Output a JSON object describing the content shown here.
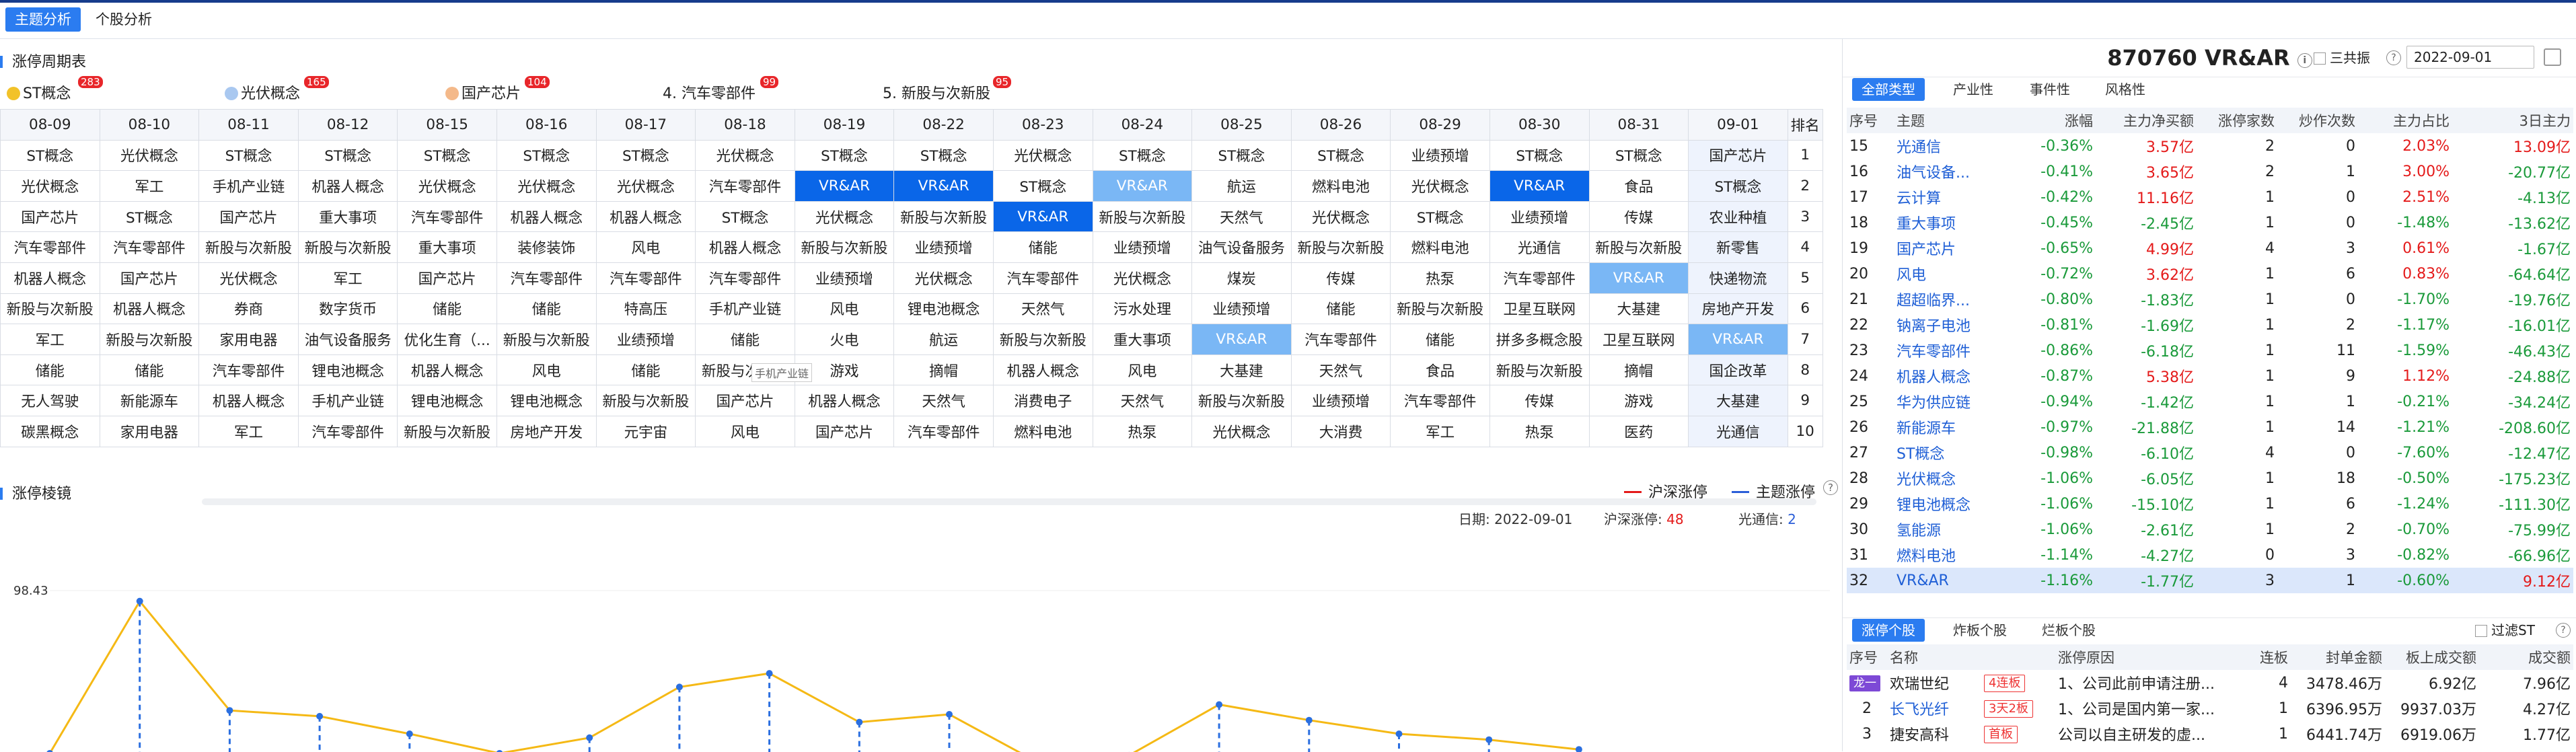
{
  "top_tabs": [
    "主题分析",
    "个股分析"
  ],
  "left": {
    "cycle_title": "涨停周期表",
    "hot": [
      {
        "label": "ST概念",
        "count": "283",
        "color": "#f2c229"
      },
      {
        "label": "光伏概念",
        "count": "165",
        "color": "#a9c8f0"
      },
      {
        "label": "国产芯片",
        "count": "104",
        "color": "#f4b98a"
      },
      {
        "label": "4. 汽车零部件",
        "count": "99",
        "color": ""
      },
      {
        "label": "5. 新股与次新股",
        "count": "95",
        "color": ""
      }
    ],
    "dates": [
      "08-09",
      "08-10",
      "08-11",
      "08-12",
      "08-15",
      "08-16",
      "08-17",
      "08-18",
      "08-19",
      "08-22",
      "08-23",
      "08-24",
      "08-25",
      "08-26",
      "08-29",
      "08-30",
      "08-31",
      "09-01"
    ],
    "rank_header": "排名",
    "rows": [
      [
        "ST概念",
        "光伏概念",
        "ST概念",
        "ST概念",
        "ST概念",
        "ST概念",
        "ST概念",
        "光伏概念",
        "ST概念",
        "ST概念",
        "光伏概念",
        "ST概念",
        "ST概念",
        "ST概念",
        "业绩预增",
        "ST概念",
        "ST概念",
        "国产芯片"
      ],
      [
        "光伏概念",
        "军工",
        "手机产业链",
        "机器人概念",
        "光伏概念",
        "光伏概念",
        "光伏概念",
        "汽车零部件",
        "VR&AR",
        "VR&AR",
        "ST概念",
        "VR&AR",
        "航运",
        "燃料电池",
        "光伏概念",
        "VR&AR",
        "食品",
        "ST概念"
      ],
      [
        "国产芯片",
        "ST概念",
        "国产芯片",
        "重大事项",
        "汽车零部件",
        "机器人概念",
        "机器人概念",
        "ST概念",
        "光伏概念",
        "新股与次新股",
        "VR&AR",
        "新股与次新股",
        "天然气",
        "光伏概念",
        "ST概念",
        "业绩预增",
        "传媒",
        "农业种植"
      ],
      [
        "汽车零部件",
        "汽车零部件",
        "新股与次新股",
        "新股与次新股",
        "重大事项",
        "装修装饰",
        "风电",
        "机器人概念",
        "新股与次新股",
        "业绩预增",
        "储能",
        "业绩预增",
        "油气设备服务",
        "新股与次新股",
        "燃料电池",
        "光通信",
        "新股与次新股",
        "新零售"
      ],
      [
        "机器人概念",
        "国产芯片",
        "光伏概念",
        "军工",
        "国产芯片",
        "汽车零部件",
        "汽车零部件",
        "汽车零部件",
        "业绩预增",
        "光伏概念",
        "汽车零部件",
        "光伏概念",
        "煤炭",
        "传媒",
        "热泵",
        "汽车零部件",
        "VR&AR",
        "快递物流"
      ],
      [
        "新股与次新股",
        "机器人概念",
        "券商",
        "数字货币",
        "储能",
        "储能",
        "特高压",
        "手机产业链",
        "风电",
        "锂电池概念",
        "天然气",
        "污水处理",
        "业绩预增",
        "储能",
        "新股与次新股",
        "卫星互联网",
        "大基建",
        "房地产开发"
      ],
      [
        "军工",
        "新股与次新股",
        "家用电器",
        "油气设备服务",
        "优化生育（...",
        "新股与次新股",
        "业绩预增",
        "储能",
        "火电",
        "航运",
        "新股与次新股",
        "重大事项",
        "VR&AR",
        "汽车零部件",
        "储能",
        "拼多多概念股",
        "卫星互联网",
        "VR&AR"
      ],
      [
        "储能",
        "储能",
        "汽车零部件",
        "锂电池概念",
        "机器人概念",
        "风电",
        "储能",
        "新股与次新股",
        "游戏",
        "摘帽",
        "机器人概念",
        "风电",
        "大基建",
        "天然气",
        "食品",
        "新股与次新股",
        "摘帽",
        "国企改革"
      ],
      [
        "无人驾驶",
        "新能源车",
        "机器人概念",
        "手机产业链",
        "锂电池概念",
        "锂电池概念",
        "新股与次新股",
        "国产芯片",
        "机器人概念",
        "天然气",
        "消费电子",
        "天然气",
        "新股与次新股",
        "业绩预增",
        "汽车零部件",
        "传媒",
        "游戏",
        "大基建"
      ],
      [
        "碳黑概念",
        "家用电器",
        "军工",
        "汽车零部件",
        "新股与次新股",
        "房地产开发",
        "元宇宙",
        "风电",
        "国产芯片",
        "汽车零部件",
        "燃料电池",
        "热泵",
        "光伏概念",
        "大消费",
        "军工",
        "热泵",
        "医药",
        "光通信"
      ]
    ],
    "ranks": [
      "1",
      "2",
      "3",
      "4",
      "5",
      "6",
      "7",
      "8",
      "9",
      "10"
    ],
    "tooltip": "手机产业链",
    "mirror_title": "涨停棱镜",
    "legend": [
      "沪深涨停",
      "主题涨停"
    ],
    "info_date_label": "日期:",
    "info_date": "2022-09-01",
    "info_hs_label": "沪深涨停:",
    "info_hs": "48",
    "info_theme_label": "光通信:",
    "info_theme": "2",
    "chart_data": {
      "type": "line",
      "y_tick": "98.43",
      "series": [
        {
          "name": "沪深涨停",
          "values": [
            null,
            null,
            null,
            null,
            null,
            null,
            null,
            null,
            null,
            null,
            null,
            null,
            null,
            null,
            null,
            null,
            null,
            null
          ]
        },
        {
          "name": "主题涨停",
          "values": [
            70,
            148,
            92,
            89,
            80,
            70,
            78,
            104,
            111,
            86,
            90,
            65,
            69,
            95,
            87,
            80,
            77,
            72
          ]
        }
      ]
    }
  },
  "right": {
    "title": "870760 VR&AR",
    "sanban_label": "三共振",
    "date": "2022-09-01",
    "filters": [
      "全部类型",
      "产业性",
      "事件性",
      "风格性"
    ],
    "cols": [
      "序号",
      "主题",
      "涨幅",
      "主力净买额",
      "涨停家数",
      "炒作次数",
      "主力占比",
      "3日主力"
    ],
    "rows": [
      [
        "15",
        "光通信",
        "-0.36%",
        "3.57亿",
        "2",
        "0",
        "2.03%",
        "13.09亿"
      ],
      [
        "16",
        "油气设备...",
        "-0.41%",
        "3.65亿",
        "2",
        "1",
        "3.00%",
        "-20.77亿"
      ],
      [
        "17",
        "云计算",
        "-0.42%",
        "11.16亿",
        "1",
        "0",
        "2.51%",
        "-4.13亿"
      ],
      [
        "18",
        "重大事项",
        "-0.45%",
        "-2.45亿",
        "1",
        "0",
        "-1.48%",
        "-13.62亿"
      ],
      [
        "19",
        "国产芯片",
        "-0.65%",
        "4.99亿",
        "4",
        "3",
        "0.61%",
        "-1.67亿"
      ],
      [
        "20",
        "风电",
        "-0.72%",
        "3.62亿",
        "1",
        "6",
        "0.83%",
        "-64.64亿"
      ],
      [
        "21",
        "超超临界...",
        "-0.80%",
        "-1.83亿",
        "1",
        "0",
        "-1.70%",
        "-19.76亿"
      ],
      [
        "22",
        "钠离子电池",
        "-0.81%",
        "-1.69亿",
        "1",
        "2",
        "-1.17%",
        "-16.01亿"
      ],
      [
        "23",
        "汽车零部件",
        "-0.86%",
        "-6.18亿",
        "1",
        "11",
        "-1.59%",
        "-46.43亿"
      ],
      [
        "24",
        "机器人概念",
        "-0.87%",
        "5.38亿",
        "1",
        "9",
        "1.12%",
        "-24.88亿"
      ],
      [
        "25",
        "华为供应链",
        "-0.94%",
        "-1.42亿",
        "1",
        "1",
        "-0.21%",
        "-34.24亿"
      ],
      [
        "26",
        "新能源车",
        "-0.97%",
        "-21.88亿",
        "1",
        "14",
        "-1.21%",
        "-208.60亿"
      ],
      [
        "27",
        "ST概念",
        "-0.98%",
        "-6.10亿",
        "4",
        "0",
        "-7.60%",
        "-12.47亿"
      ],
      [
        "28",
        "光伏概念",
        "-1.06%",
        "-6.05亿",
        "1",
        "18",
        "-0.50%",
        "-175.23亿"
      ],
      [
        "29",
        "锂电池概念",
        "-1.06%",
        "-15.10亿",
        "1",
        "6",
        "-1.24%",
        "-111.30亿"
      ],
      [
        "30",
        "氢能源",
        "-1.06%",
        "-2.61亿",
        "1",
        "2",
        "-0.70%",
        "-75.99亿"
      ],
      [
        "31",
        "燃料电池",
        "-1.14%",
        "-4.27亿",
        "0",
        "3",
        "-0.82%",
        "-66.96亿"
      ],
      [
        "32",
        "VR&AR",
        "-1.16%",
        "-1.77亿",
        "3",
        "1",
        "-0.60%",
        "9.12亿"
      ]
    ],
    "stock_tabs": [
      "涨停个股",
      "炸板个股",
      "烂板个股"
    ],
    "filter_st": "过滤ST",
    "stock_cols": [
      "序号",
      "名称",
      "",
      "涨停原因",
      "连板",
      "封单金额",
      "板上成交额",
      "成交额"
    ],
    "stocks": [
      [
        "龙一",
        "欢瑞世纪",
        "4连板",
        "1、公司此前申请注册...",
        "4",
        "3478.46万",
        "6.92亿",
        "7.96亿"
      ],
      [
        "2",
        "长飞光纤",
        "3天2板",
        "1、公司是国内第一家...",
        "1",
        "6396.95万",
        "9937.03万",
        "4.27亿"
      ],
      [
        "3",
        "捷安高科",
        "首板",
        "公司以自主研发的虚...",
        "1",
        "6441.74万",
        "6919.06万",
        "1.77亿"
      ]
    ]
  }
}
